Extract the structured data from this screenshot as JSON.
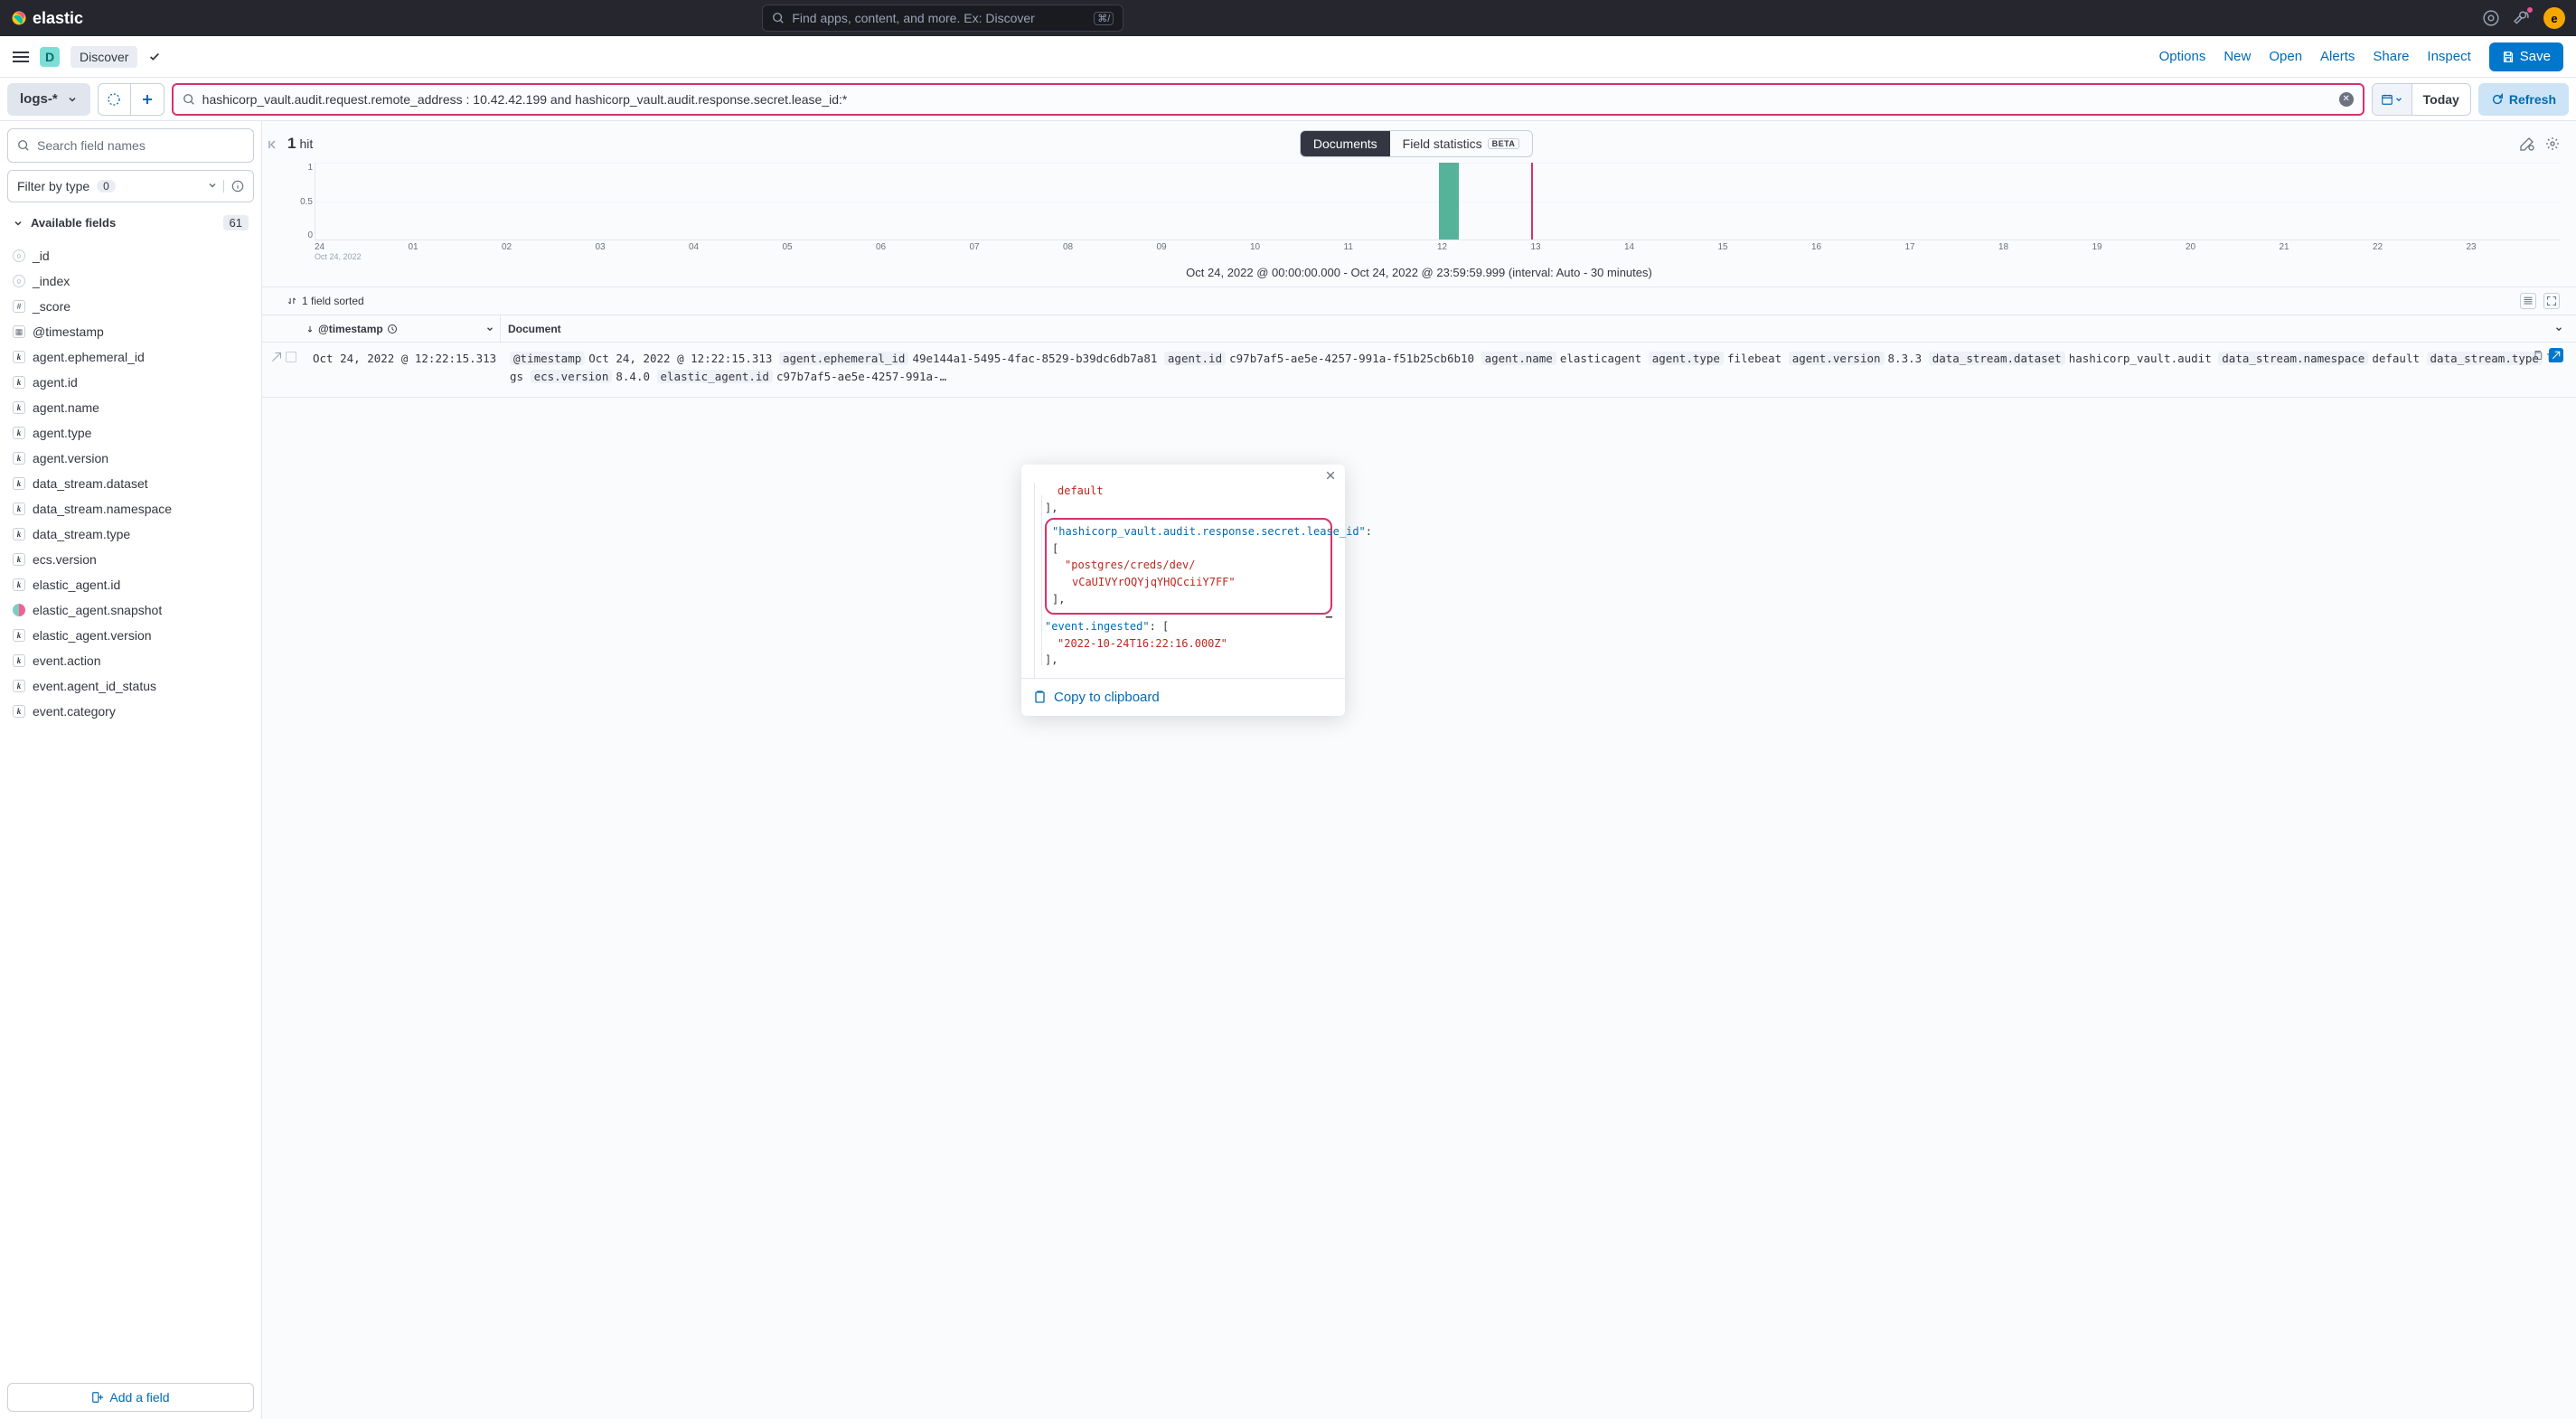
{
  "topbar": {
    "logo_text": "elastic",
    "search_placeholder": "Find apps, content, and more. Ex: Discover",
    "shortcut": "⌘/",
    "avatar_initial": "e"
  },
  "appbar": {
    "badge_letter": "D",
    "app_name": "Discover",
    "actions": {
      "options": "Options",
      "new": "New",
      "open": "Open",
      "alerts": "Alerts",
      "share": "Share",
      "inspect": "Inspect",
      "save": "Save"
    }
  },
  "querybar": {
    "index_pattern": "logs-*",
    "query": "hashicorp_vault.audit.request.remote_address : 10.42.42.199 and hashicorp_vault.audit.response.secret.lease_id:*",
    "date_label": "Today",
    "refresh": "Refresh"
  },
  "sidebar": {
    "search_placeholder": "Search field names",
    "filter_label": "Filter by type",
    "filter_count": "0",
    "available_label": "Available fields",
    "available_count": "61",
    "fields": [
      {
        "type": "circle",
        "name": "_id"
      },
      {
        "type": "circle",
        "name": "_index"
      },
      {
        "type": "hash",
        "name": "_score"
      },
      {
        "type": "cal",
        "name": "@timestamp"
      },
      {
        "type": "k",
        "name": "agent.ephemeral_id"
      },
      {
        "type": "k",
        "name": "agent.id"
      },
      {
        "type": "k",
        "name": "agent.name"
      },
      {
        "type": "k",
        "name": "agent.type"
      },
      {
        "type": "k",
        "name": "agent.version"
      },
      {
        "type": "k",
        "name": "data_stream.dataset"
      },
      {
        "type": "k",
        "name": "data_stream.namespace"
      },
      {
        "type": "k",
        "name": "data_stream.type"
      },
      {
        "type": "k",
        "name": "ecs.version"
      },
      {
        "type": "k",
        "name": "elastic_agent.id"
      },
      {
        "type": "bool",
        "name": "elastic_agent.snapshot"
      },
      {
        "type": "k",
        "name": "elastic_agent.version"
      },
      {
        "type": "k",
        "name": "event.action"
      },
      {
        "type": "k",
        "name": "event.agent_id_status"
      },
      {
        "type": "k",
        "name": "event.category"
      }
    ],
    "add_field": "Add a field"
  },
  "content": {
    "hits_number": "1",
    "hits_label": "hit",
    "tabs": {
      "documents": "Documents",
      "field_stats": "Field statistics",
      "beta": "BETA"
    },
    "sort_info": "1 field sorted",
    "interval_label": "Oct 24, 2022 @ 00:00:00.000 - Oct 24, 2022 @ 23:59:59.999 (interval: Auto - 30 minutes)",
    "columns": {
      "timestamp": "@timestamp",
      "document": "Document"
    },
    "row": {
      "timestamp": "Oct 24, 2022 @ 12:22:15.313",
      "kv": [
        {
          "k": "@timestamp",
          "v": "Oct 24, 2022 @ 12:22:15.313"
        },
        {
          "k": "agent.ephemeral_id",
          "v": "49e144a1-5495-4fac-8529-b39dc6db7a81"
        },
        {
          "k": "agent.id",
          "v": "c97b7af5-ae5e-4257-991a-f51b25cb6b10"
        },
        {
          "k": "agent.name",
          "v": "elasticagent"
        },
        {
          "k": "agent.type",
          "v": "filebeat"
        },
        {
          "k": "agent.version",
          "v": "8.3.3"
        },
        {
          "k": "data_stream.dataset",
          "v": "hashicorp_vault.audit"
        },
        {
          "k": "data_stream.namespace",
          "v": "default"
        },
        {
          "k": "data_stream.type",
          "v": "logs"
        },
        {
          "k": "ecs.version",
          "v": "8.4.0"
        },
        {
          "k": "elastic_agent.id",
          "v": "c97b7af5-ae5e-4257-991a-…"
        }
      ]
    }
  },
  "chart_data": {
    "type": "bar",
    "categories": [
      "24",
      "01",
      "02",
      "03",
      "04",
      "05",
      "06",
      "07",
      "08",
      "09",
      "10",
      "11",
      "12",
      "13",
      "14",
      "15",
      "16",
      "17",
      "18",
      "19",
      "20",
      "21",
      "22",
      "23"
    ],
    "sub_category_0": "Oct 24, 2022",
    "values": [
      0,
      0,
      0,
      0,
      0,
      0,
      0,
      0,
      0,
      0,
      0,
      0,
      1,
      0,
      0,
      0,
      0,
      0,
      0,
      0,
      0,
      0,
      0,
      0
    ],
    "marker_x_index": 13,
    "ylim": [
      0,
      1
    ],
    "y_ticks": [
      "1",
      "0.5",
      "0"
    ],
    "title": "",
    "xlabel": "",
    "ylabel": ""
  },
  "popover": {
    "pre_value": "default",
    "lease_key": "\"hashicorp_vault.audit.response.secret.lease_id\"",
    "lease_val_line1": "\"postgres/creds/dev/",
    "lease_val_line2": "vCaUIVYrOQYjqYHQCciiY7FF\"",
    "ingested_key": "\"event.ingested\"",
    "ingested_val": "\"2022-10-24T16:22:16.000Z\"",
    "copy_label": "Copy to clipboard"
  }
}
